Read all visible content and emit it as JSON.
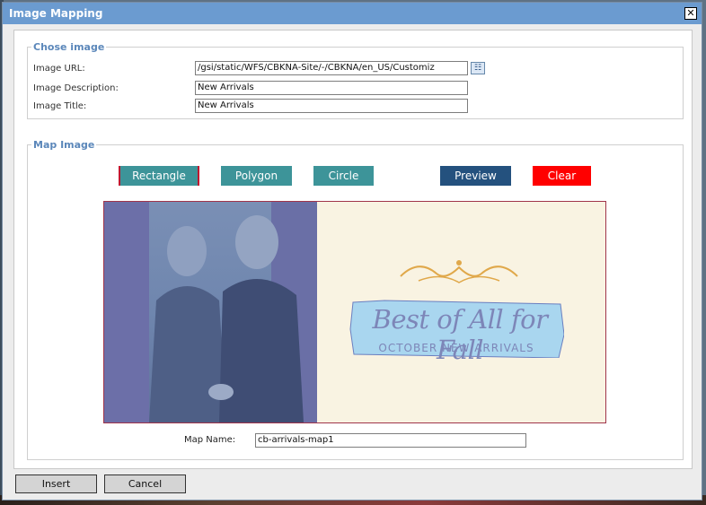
{
  "dialog": {
    "title": "Image Mapping",
    "close_glyph": "✕"
  },
  "chose_image": {
    "legend": "Chose image",
    "url_label": "Image URL:",
    "url_value": "/gsi/static/WFS/CBKNA-Site/-/CBKNA/en_US/Customiz",
    "description_label": "Image Description:",
    "description_value": "New Arrivals",
    "title_label": "Image Title:",
    "title_value": "New Arrivals",
    "browse_icon": "browse-icon"
  },
  "map_image": {
    "legend": "Map Image",
    "tools": {
      "rectangle": "Rectangle",
      "polygon": "Polygon",
      "circle": "Circle",
      "preview": "Preview",
      "clear": "Clear"
    },
    "image": {
      "headline": "Best of All for Fall",
      "subhead": "OCTOBER NEW ARRIVALS"
    },
    "map_name_label": "Map Name:",
    "map_name_value": "cb-arrivals-map1"
  },
  "footer": {
    "insert": "Insert",
    "cancel": "Cancel"
  },
  "colors": {
    "titlebar": "#6b9bd0",
    "tool_teal": "#3d9499",
    "preview_blue": "#24517e",
    "clear_red": "#ff0000",
    "legend_blue": "#5b87ba"
  }
}
